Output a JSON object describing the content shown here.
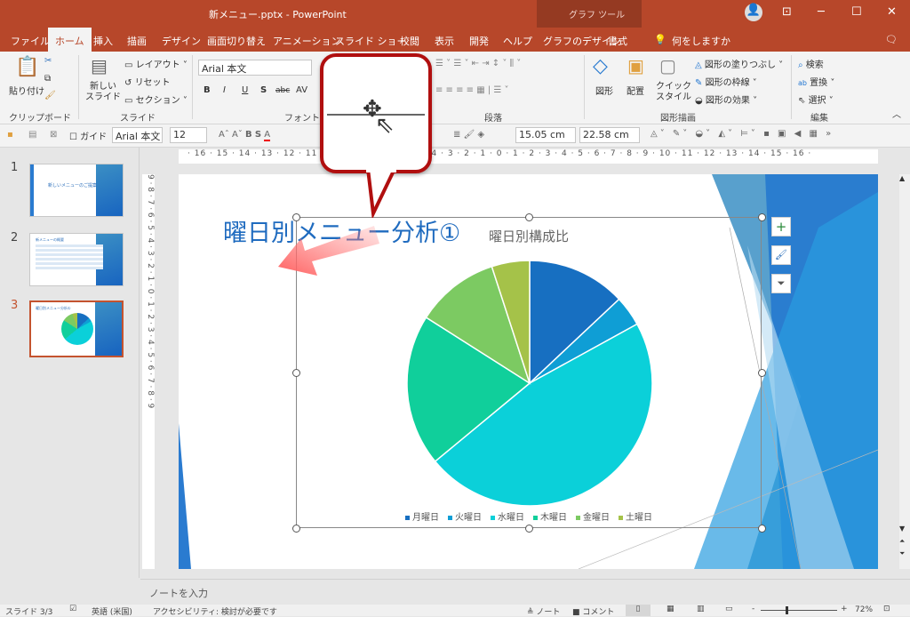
{
  "window": {
    "title": "新メニュー.pptx  -  PowerPoint",
    "context_tab": "グラフ ツール",
    "controls": [
      "account",
      "ribbon-display",
      "minimize",
      "maximize",
      "close"
    ]
  },
  "tabs": [
    "ファイル",
    "ホーム",
    "挿入",
    "描画",
    "デザイン",
    "画面切り替え",
    "アニメーション",
    "スライド ショー",
    "校閲",
    "表示",
    "開発",
    "ヘルプ",
    "グラフのデザイン",
    "書式"
  ],
  "active_tab": "ホーム",
  "tell_me": "何をしますか",
  "ribbon": {
    "clipboard": {
      "paste": "貼り付け",
      "group": "クリップボード"
    },
    "slides": {
      "new_slide": "新しい\nスライド",
      "layout": "レイアウト",
      "reset": "リセット",
      "section": "セクション",
      "group": "スライド"
    },
    "font": {
      "font_name": "Arial 本文",
      "group": "フォント",
      "buttons": [
        "B",
        "I",
        "U",
        "S",
        "abc",
        "AV"
      ]
    },
    "paragraph": {
      "group": "段落"
    },
    "drawing": {
      "shapes": "図形",
      "arrange": "配置",
      "quick_style": "クイック\nスタイル",
      "fill": "図形の塗りつぶし",
      "outline": "図形の枠線",
      "effects": "図形の効果",
      "group": "図形描画"
    },
    "editing": {
      "find": "検索",
      "replace": "置換",
      "select": "選択",
      "group": "編集"
    }
  },
  "toolbar2": {
    "guide": "ガイド",
    "font": "Arial 本文",
    "size": "12",
    "height": "15.05 cm",
    "width": "22.58 cm"
  },
  "ruler": "· 16 · 15 · 14 · 13 · 12 · 11 · 10 · 9 · 8 · 7 · 6 · 5 · 4 · 3 · 2 · 1 · 0 · 1 · 2 · 3 · 4 · 5 · 6 · 7 · 8 · 9 · 10 · 11 · 12 · 13 · 14 · 15 · 16 ·",
  "vruler": "9 · 8 · 7 · 6 · 5 · 4 · 3 · 2 · 1 · 0 · 1 · 2 · 3 · 4 · 5 · 6 · 7 · 8 · 9",
  "thumbnails": [
    {
      "num": "1",
      "title": "新しいメニューのご提案"
    },
    {
      "num": "2",
      "title": "新メニューの概要"
    },
    {
      "num": "3",
      "title": "曜日別メニュー分析①",
      "selected": true
    }
  ],
  "slide": {
    "title": "曜日別メニュー分析①"
  },
  "chart_data": {
    "type": "pie",
    "title": "曜日別構成比",
    "categories": [
      "月曜日",
      "火曜日",
      "水曜日",
      "木曜日",
      "金曜日",
      "土曜日"
    ],
    "values": [
      13,
      4,
      47,
      20,
      11,
      5
    ],
    "colors": [
      "#176fc1",
      "#0f9ed5",
      "#0bd0d9",
      "#10cf9b",
      "#7cca62",
      "#a5c249"
    ],
    "legend": "bottom"
  },
  "chart_buttons": [
    "chart-elements",
    "chart-styles",
    "chart-filters"
  ],
  "notes_placeholder": "ノートを入力",
  "status": {
    "slide": "スライド 3/3",
    "language": "英語 (米国)",
    "accessibility": "アクセシビリティ: 検討が必要です",
    "notes": "ノート",
    "comments": "コメント",
    "zoom": "72%"
  },
  "accent": "#b7472a"
}
